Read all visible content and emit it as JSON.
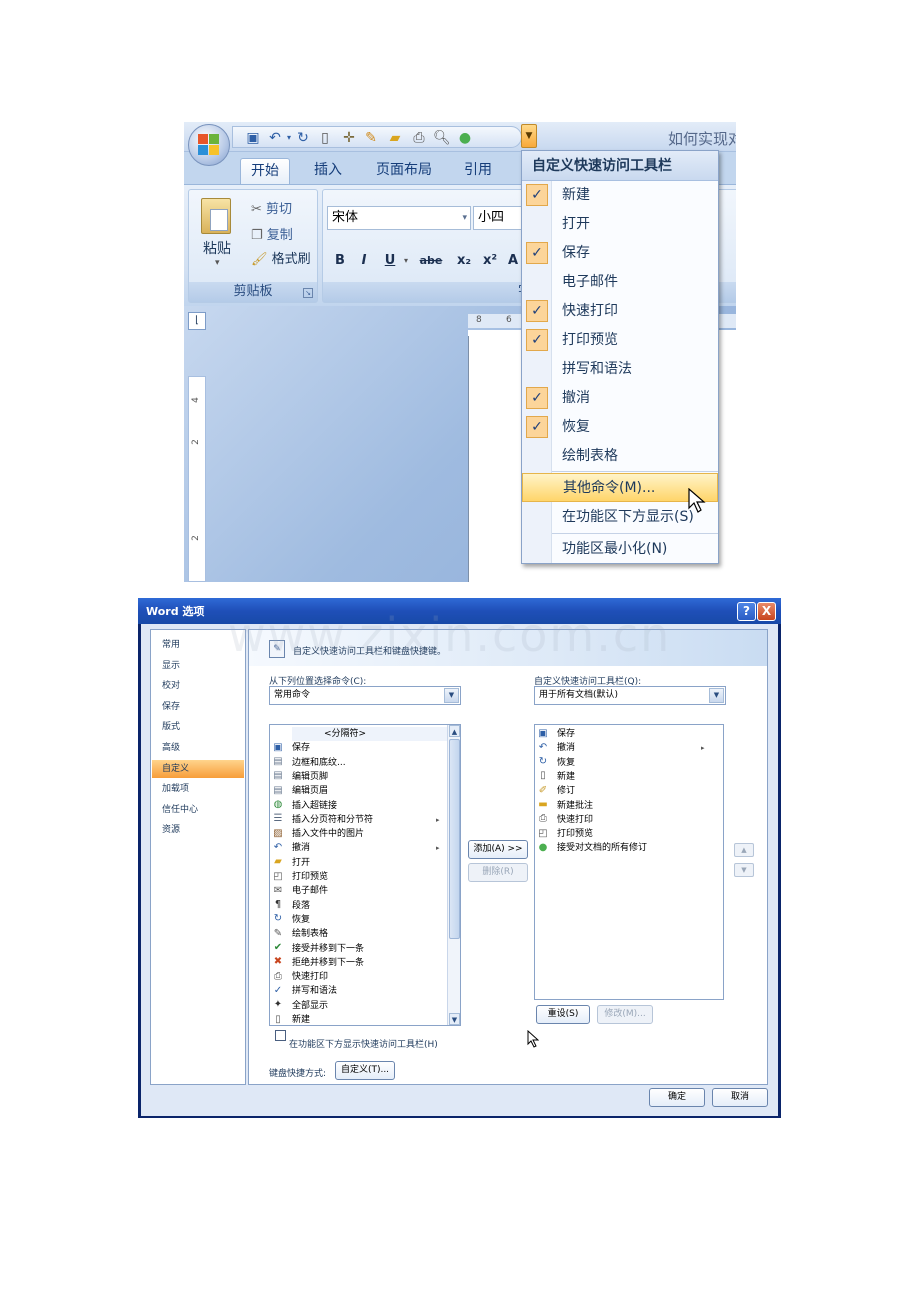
{
  "word_window": {
    "doc_title": "如何实现对",
    "tabs": [
      "开始",
      "插入",
      "页面布局",
      "引用"
    ],
    "clipboard": {
      "paste_label": "粘贴",
      "cut_label": "剪切",
      "copy_label": "复制",
      "format_painter_label": "格式刷",
      "group_label": "剪贴板"
    },
    "font_group": {
      "font_name": "宋体",
      "font_size": "小四",
      "bold": "B",
      "italic": "I",
      "underline": "U",
      "strikethrough": "abe",
      "subscript": "x₂",
      "superscript": "x²",
      "font_color": "A",
      "group_label": "字体"
    },
    "ruler": {
      "numbers": [
        "8",
        "6"
      ],
      "vnumbers": [
        "4",
        "2",
        "2"
      ]
    }
  },
  "qat_menu": {
    "title": "自定义快速访问工具栏",
    "items": [
      {
        "label": "新建",
        "checked": true
      },
      {
        "label": "打开",
        "checked": false
      },
      {
        "label": "保存",
        "checked": true
      },
      {
        "label": "电子邮件",
        "checked": false
      },
      {
        "label": "快速打印",
        "checked": true
      },
      {
        "label": "打印预览",
        "checked": true
      },
      {
        "label": "拼写和语法",
        "checked": false
      },
      {
        "label": "撤消",
        "checked": true
      },
      {
        "label": "恢复",
        "checked": true
      },
      {
        "label": "绘制表格",
        "checked": false
      }
    ],
    "more_commands": "其他命令(M)...",
    "show_below": "在功能区下方显示(S)",
    "minimize": "功能区最小化(N)"
  },
  "options_dialog": {
    "title": "Word 选项",
    "nav": [
      "常用",
      "显示",
      "校对",
      "保存",
      "版式",
      "高级",
      "自定义",
      "加载项",
      "信任中心",
      "资源"
    ],
    "nav_selected": "自定义",
    "header_text": "自定义快速访问工具栏和键盘快捷键。",
    "choose_from_label": "从下列位置选择命令(C):",
    "choose_from_value": "常用命令",
    "customize_label": "自定义快速访问工具栏(Q):",
    "customize_value": "用于所有文档(默认)",
    "commands": [
      {
        "label": "<分隔符>",
        "icon": ""
      },
      {
        "label": "保存",
        "icon": "save-icon"
      },
      {
        "label": "边框和底纹...",
        "icon": "page-icon"
      },
      {
        "label": "编辑页脚",
        "icon": "page-icon"
      },
      {
        "label": "编辑页眉",
        "icon": "page-icon"
      },
      {
        "label": "插入超链接",
        "icon": "link-icon"
      },
      {
        "label": "插入分页符和分节符",
        "icon": "page-break-icon",
        "submenu": true
      },
      {
        "label": "插入文件中的图片",
        "icon": "picture-icon"
      },
      {
        "label": "撤消",
        "icon": "undo-icon",
        "submenu": true
      },
      {
        "label": "打开",
        "icon": "folder-icon"
      },
      {
        "label": "打印预览",
        "icon": "print-preview-icon"
      },
      {
        "label": "电子邮件",
        "icon": "email-icon"
      },
      {
        "label": "段落",
        "icon": "paragraph-icon"
      },
      {
        "label": "恢复",
        "icon": "redo-icon"
      },
      {
        "label": "绘制表格",
        "icon": "pencil-icon"
      },
      {
        "label": "接受并移到下一条",
        "icon": "accept-icon"
      },
      {
        "label": "拒绝并移到下一条",
        "icon": "reject-icon"
      },
      {
        "label": "快速打印",
        "icon": "printer-icon"
      },
      {
        "label": "拼写和语法",
        "icon": "spelling-icon"
      },
      {
        "label": "全部显示",
        "icon": "show-all-icon"
      },
      {
        "label": "新建",
        "icon": "new-icon"
      }
    ],
    "qat_commands": [
      {
        "label": "保存",
        "icon": "save-icon"
      },
      {
        "label": "撤消",
        "icon": "undo-icon",
        "submenu": true
      },
      {
        "label": "恢复",
        "icon": "redo-icon"
      },
      {
        "label": "新建",
        "icon": "new-icon"
      },
      {
        "label": "修订",
        "icon": "track-changes-icon"
      },
      {
        "label": "新建批注",
        "icon": "comment-icon"
      },
      {
        "label": "快速打印",
        "icon": "printer-icon"
      },
      {
        "label": "打印预览",
        "icon": "print-preview-icon"
      },
      {
        "label": "接受对文档的所有修订",
        "icon": "accept-all-icon"
      }
    ],
    "add_button": "添加(A) >>",
    "remove_button": "删除(R)",
    "reset_button": "重设(S)",
    "modify_button": "修改(M)...",
    "show_below_checkbox": "在功能区下方显示快速访问工具栏(H)",
    "keyboard_label": "键盘快捷方式:",
    "customize_button": "自定义(T)...",
    "ok_button": "确定",
    "cancel_button": "取消",
    "help_button": "?",
    "close_button": "X"
  },
  "watermark": "www.zixin.com.cn",
  "colors": {
    "menu_check_bg": "#fcd59a",
    "menu_hover": "#ffd56a",
    "nav_selected": "#f79d3a",
    "dialog_titlebar": "#1f4fb8"
  }
}
